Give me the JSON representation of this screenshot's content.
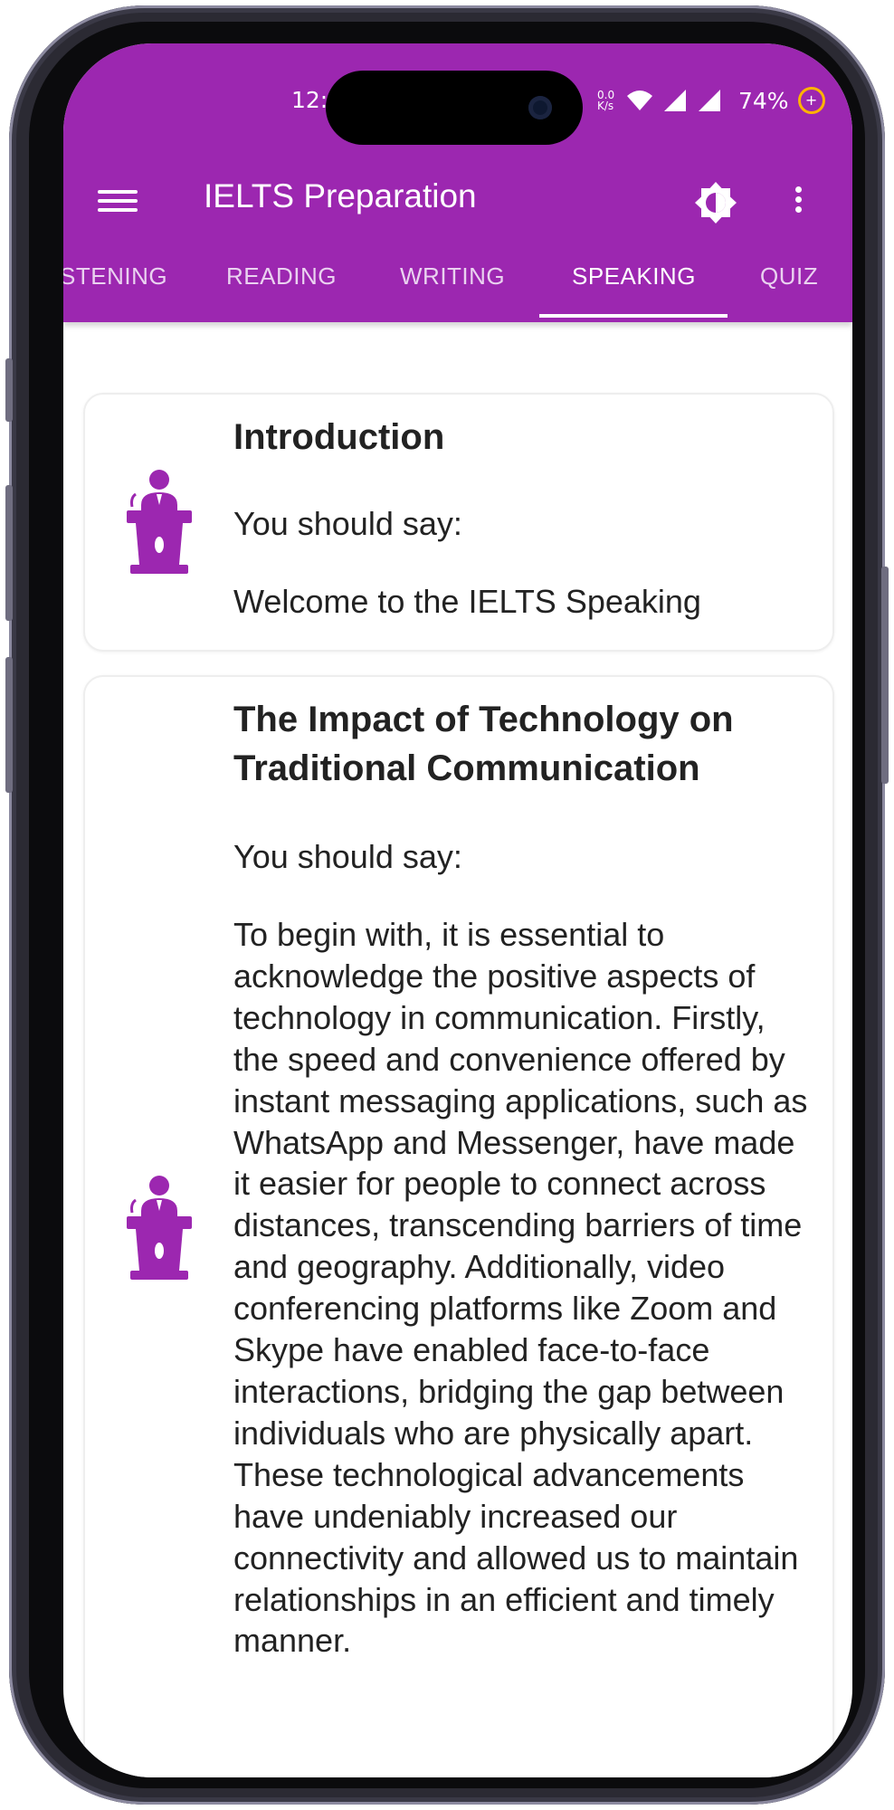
{
  "status_bar": {
    "time": "12:0",
    "network_speed": "0.0 K/s",
    "battery_percent": "74%",
    "battery_saver_symbol": "+"
  },
  "app_bar": {
    "title": "IELTS Preparation",
    "menu_icon": "hamburger-menu-icon",
    "theme_icon": "brightness-icon",
    "more_icon": "more-vertical-icon",
    "color": "#9c27b0"
  },
  "tabs": [
    {
      "label": "STENING",
      "active": false
    },
    {
      "label": "READING",
      "active": false
    },
    {
      "label": "WRITING",
      "active": false
    },
    {
      "label": "SPEAKING",
      "active": true
    },
    {
      "label": "QUIZ",
      "active": false
    }
  ],
  "cards": [
    {
      "icon": "speaker-podium-icon",
      "title": "Introduction",
      "subtitle": "You should say:",
      "body": "Welcome to the IELTS Speaking"
    },
    {
      "icon": "speaker-podium-icon",
      "title": "The Impact of Technology on Traditional Communication",
      "subtitle": "You should say:",
      "body": "To begin with, it is essential to acknowledge the positive aspects of technology in communication. Firstly, the speed and convenience offered by instant messaging applications, such as WhatsApp and Messenger, have made it easier for people to connect across distances, transcending barriers of time and geography. Additionally, video conferencing platforms like Zoom and Skype have enabled face-to-face interactions, bridging the gap between individuals who are physically apart. These technological advancements have undeniably increased our connectivity and allowed us to maintain relationships in an efficient and timely manner."
    }
  ],
  "colors": {
    "accent": "#9c27b0",
    "icon": "#9c27b0",
    "text": "#222222"
  }
}
